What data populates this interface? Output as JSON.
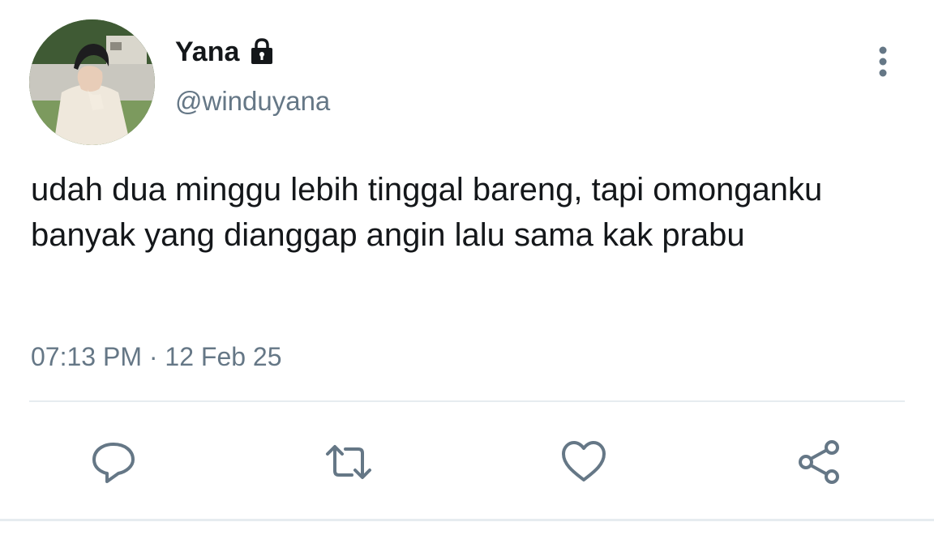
{
  "tweet": {
    "display_name": "Yana",
    "handle": "@winduyana",
    "text": "udah dua minggu lebih tinggal bareng, tapi omonganku banyak yang dianggap angin lalu sama kak prabu",
    "timestamp": "07:13 PM · 12 Feb 25",
    "protected_icon": "lock-icon",
    "menu_icon": "more-vertical-icon"
  },
  "actions": [
    {
      "name": "reply",
      "icon": "comment-icon"
    },
    {
      "name": "retweet",
      "icon": "retweet-icon"
    },
    {
      "name": "like",
      "icon": "heart-icon"
    },
    {
      "name": "share",
      "icon": "share-icon"
    }
  ],
  "colors": {
    "text": "#14171a",
    "secondary": "#657786",
    "divider": "#e6ecf0"
  }
}
